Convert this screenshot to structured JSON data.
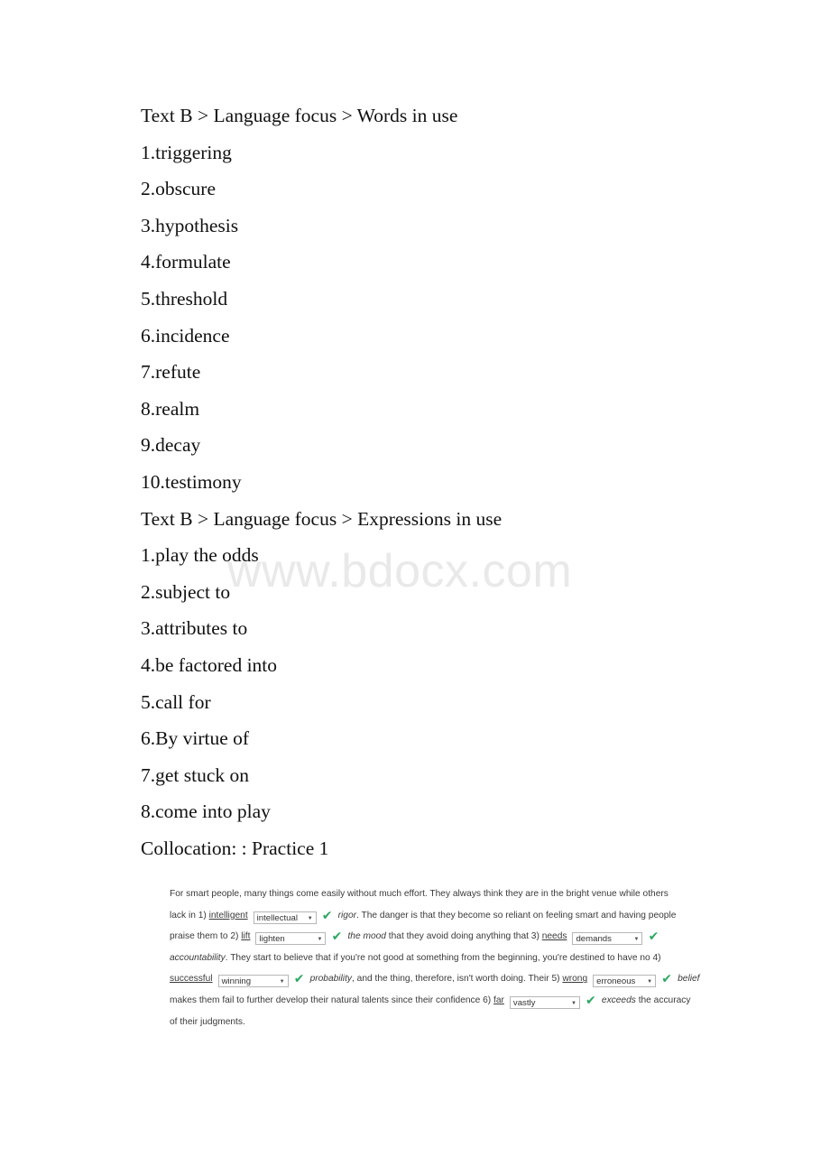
{
  "watermark": {
    "text": "www.bdocx.com",
    "color": "#e9e9e9"
  },
  "document": {
    "lines": [
      {
        "id": "heading-words-in-use",
        "text": "Text B > Language focus > Words in use"
      },
      {
        "id": "word-1",
        "text": "1.triggering"
      },
      {
        "id": "word-2",
        "text": "2.obscure"
      },
      {
        "id": "word-3",
        "text": "3.hypothesis"
      },
      {
        "id": "word-4",
        "text": "4.formulate"
      },
      {
        "id": "word-5",
        "text": "5.threshold"
      },
      {
        "id": "word-6",
        "text": "6.incidence"
      },
      {
        "id": "word-7",
        "text": "7.refute"
      },
      {
        "id": "word-8",
        "text": "8.realm"
      },
      {
        "id": "word-9",
        "text": "9.decay"
      },
      {
        "id": "word-10",
        "text": "10.testimony"
      },
      {
        "id": "heading-expressions-in-use",
        "text": "Text B > Language focus > Expressions in use"
      },
      {
        "id": "expr-1",
        "text": "1.play the odds"
      },
      {
        "id": "expr-2",
        "text": "2.subject to"
      },
      {
        "id": "expr-3",
        "text": "3.attributes to"
      },
      {
        "id": "expr-4",
        "text": "4.be factored into"
      },
      {
        "id": "expr-5",
        "text": "5.call for"
      },
      {
        "id": "expr-6",
        "text": "6.By virtue of"
      },
      {
        "id": "expr-7",
        "text": "7.get stuck on"
      },
      {
        "id": "expr-8",
        "text": "8.come into play"
      },
      {
        "id": "heading-collocation",
        "text": "Collocation: : Practice 1"
      }
    ]
  },
  "exercise": {
    "check_color": "#2fa664",
    "dropdown_arrow": "▼",
    "check_glyph": "✔",
    "t1": "For smart people, many things come easily without much effort. They always think they are in the bright venue while others",
    "t2": "lack in 1) ",
    "blank1_prompt": "intelligent",
    "blank1_value": "intellectual",
    "t3": "rigor",
    "t4": ". The danger is that they become so reliant on feeling smart and having people",
    "t5": "praise them to 2) ",
    "blank2_prompt": "lift",
    "blank2_value": "lighten",
    "t6": "the mood",
    "t7": " that they avoid doing anything that 3) ",
    "blank3_prompt": "needs",
    "blank3_value": "demands",
    "t8": "accountability",
    "t9": ". They start to believe that if you're not good at something from the beginning, you're destined to have no 4)",
    "blank4_prompt": "successful",
    "blank4_value": "winning",
    "t10": "probability",
    "t11": ", and the thing, therefore, isn't worth doing. Their 5) ",
    "blank5_prompt": "wrong",
    "blank5_value": "erroneous",
    "t12": "belief",
    "t13": "makes them fail to further develop their natural talents since their confidence 6) ",
    "blank6_prompt": "far",
    "blank6_value": "vastly",
    "t14": "exceeds",
    "t15": " the accuracy",
    "t16": "of their judgments."
  }
}
